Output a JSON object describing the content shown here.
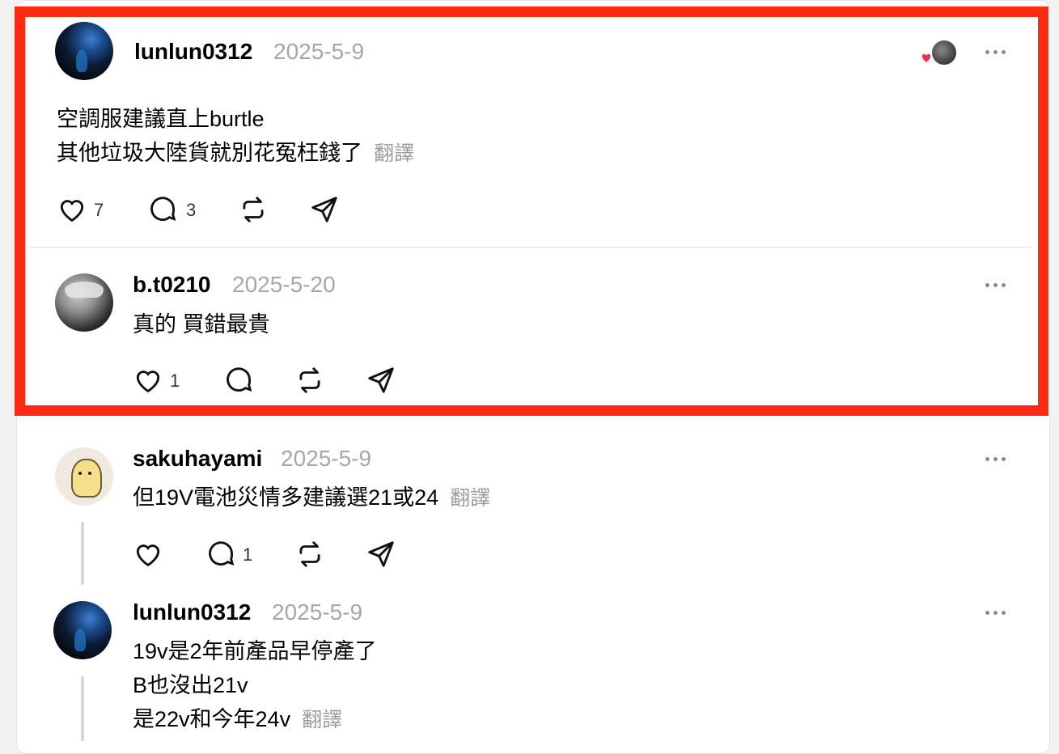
{
  "posts": [
    {
      "username": "lunlun0312",
      "date": "2025-5-9",
      "lines": [
        "空調服建議直上burtle",
        "其他垃圾大陸貨就別花冤枉錢了"
      ],
      "translate": "翻譯",
      "likes": "7",
      "comments": "3"
    },
    {
      "username": "b.t0210",
      "date": "2025-5-20",
      "lines": [
        "真的 買錯最貴"
      ],
      "likes": "1"
    },
    {
      "username": "sakuhayami",
      "date": "2025-5-9",
      "lines": [
        "但19V電池災情多建議選21或24"
      ],
      "translate": "翻譯",
      "comments": "1"
    },
    {
      "username": "lunlun0312",
      "date": "2025-5-9",
      "lines": [
        "19v是2年前產品早停產了",
        "B也沒出21v",
        "是22v和今年24v"
      ],
      "translate": "翻譯"
    }
  ],
  "colors": {
    "highlight": "#ff2a12",
    "date_gray": "#a7a7a7",
    "like_heart": "#e8344e"
  },
  "icons": [
    "heart-icon",
    "comment-icon",
    "repost-icon",
    "share-icon",
    "more-icon"
  ]
}
